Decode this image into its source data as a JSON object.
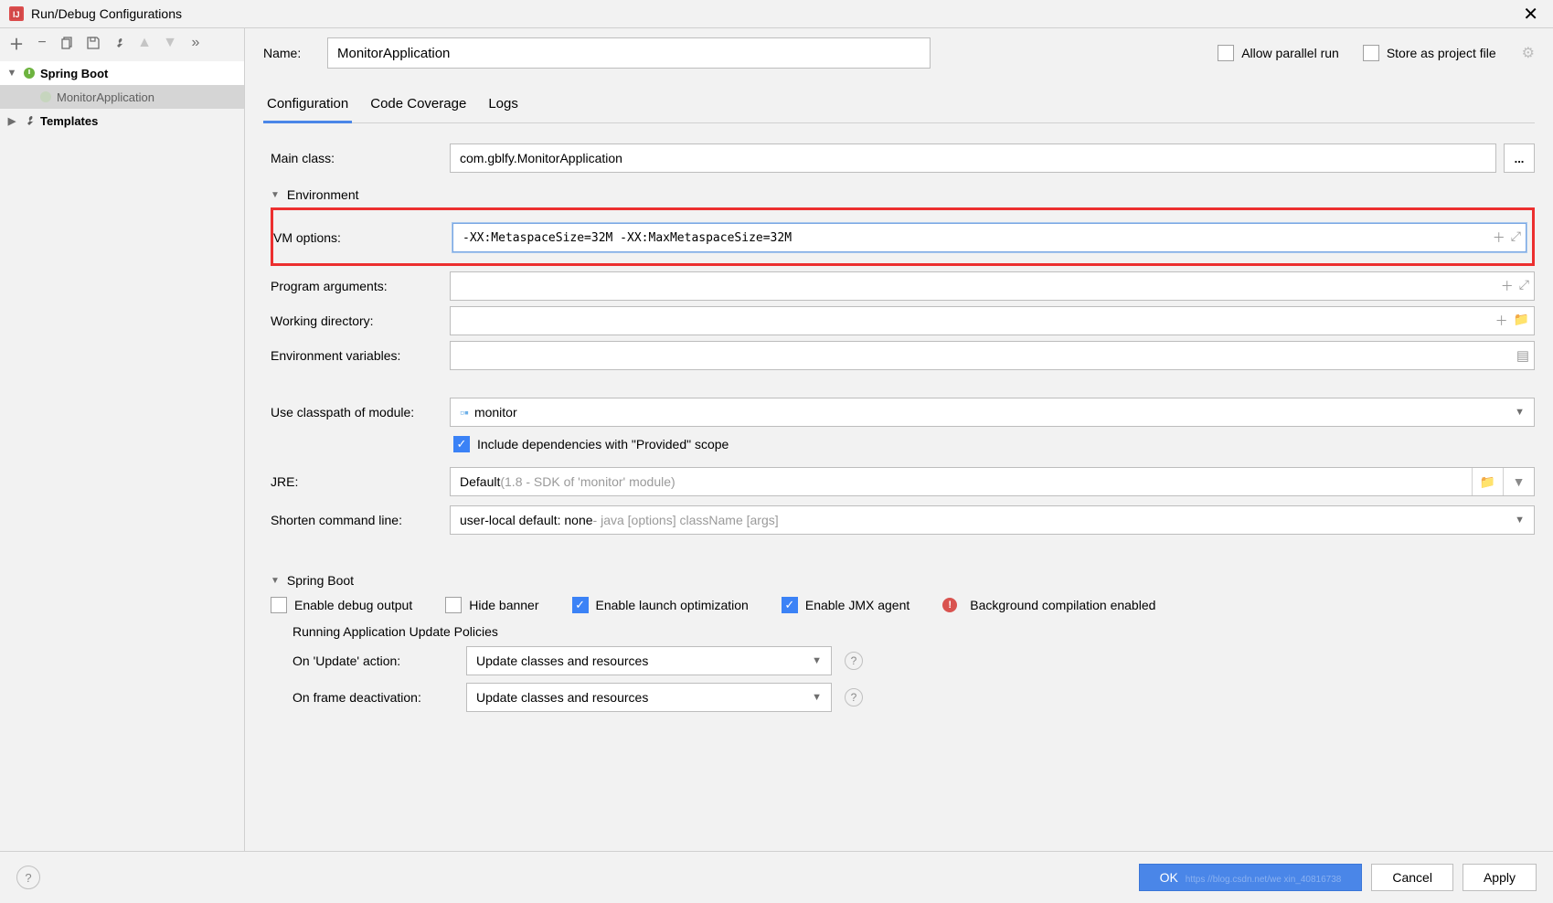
{
  "dialog": {
    "title": "Run/Debug Configurations"
  },
  "sidebar": {
    "root": {
      "label": "Spring Boot"
    },
    "child": {
      "label": "MonitorApplication"
    },
    "templates": {
      "label": "Templates"
    }
  },
  "name": {
    "label": "Name:",
    "value": "MonitorApplication",
    "allow_parallel": "Allow parallel run",
    "store_as_project": "Store as project file"
  },
  "tabs": {
    "configuration": "Configuration",
    "coverage": "Code Coverage",
    "logs": "Logs"
  },
  "form": {
    "main_class": {
      "label": "Main class:",
      "value": "com.gblfy.MonitorApplication",
      "more": "..."
    },
    "environment_section": "Environment",
    "vm_options": {
      "label": "VM options:",
      "value": "-XX:MetaspaceSize=32M -XX:MaxMetaspaceSize=32M"
    },
    "program_args": {
      "label": "Program arguments:",
      "value": ""
    },
    "working_dir": {
      "label": "Working directory:",
      "value": ""
    },
    "env_vars": {
      "label": "Environment variables:",
      "value": ""
    },
    "classpath": {
      "label": "Use classpath of module:",
      "value": "monitor"
    },
    "include_provided": "Include dependencies with \"Provided\" scope",
    "jre": {
      "label": "JRE:",
      "prefix": "Default ",
      "detail": "(1.8 - SDK of 'monitor' module)"
    },
    "shorten": {
      "label": "Shorten command line:",
      "prefix": "user-local default: none ",
      "detail": "- java [options] className [args]"
    },
    "springboot_section": "Spring Boot",
    "sb": {
      "debug_output": "Enable debug output",
      "hide_banner": "Hide banner",
      "launch_opt": "Enable launch optimization",
      "jmx_agent": "Enable JMX agent",
      "bg_compile": "Background compilation enabled"
    },
    "policies": {
      "title": "Running Application Update Policies",
      "on_update": {
        "label": "On 'Update' action:",
        "value": "Update classes and resources"
      },
      "on_frame": {
        "label": "On frame deactivation:",
        "value": "Update classes and resources"
      }
    }
  },
  "footer": {
    "ok": "OK",
    "cancel": "Cancel",
    "apply": "Apply",
    "watermark": "https //blog.csdn.net/we xin_40816738"
  }
}
